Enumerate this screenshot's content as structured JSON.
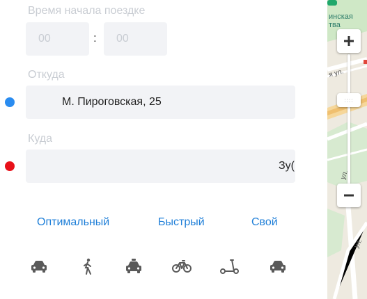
{
  "start_time": {
    "label": "Время начала поездке",
    "hours_placeholder": "00",
    "minutes_placeholder": "00",
    "separator": ":"
  },
  "from": {
    "label": "Откуда",
    "value": "М. Пироговская, 25",
    "dot_color": "#2a8cf0"
  },
  "to": {
    "label": "Куда",
    "value": "Зу(",
    "dot_color": "#e8111a"
  },
  "route_options": [
    "Оптимальный",
    "Быстрый",
    "Свой"
  ],
  "transport_modes": [
    "car-icon",
    "pedestrian-icon",
    "taxi-icon",
    "bicycle-icon",
    "scooter-icon",
    "car-sharing-icon"
  ],
  "map": {
    "place_label_line1": "инская",
    "place_label_line2": "тва",
    "street_label_1": "я ул.",
    "street_label_2": "ул.",
    "street_label_3": "ул.",
    "zoom_in": "+",
    "zoom_out": "−",
    "zoom_handle": "::::"
  },
  "colors": {
    "accent": "#1f7fd8",
    "field_bg": "#f2f3f6",
    "muted_text": "#c9cdd3"
  }
}
